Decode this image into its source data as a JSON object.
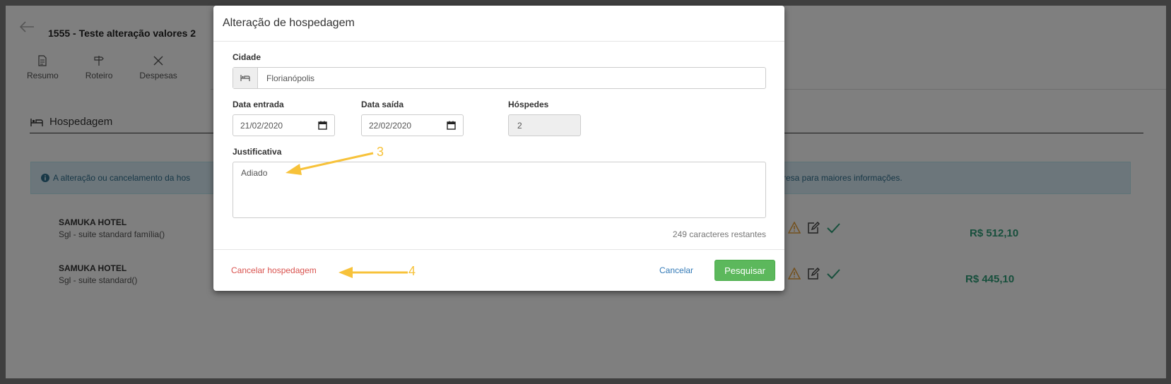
{
  "trip": {
    "title": "1555 - Teste alteração valores 2"
  },
  "nav": [
    {
      "label": "Resumo",
      "icon": "document-icon"
    },
    {
      "label": "Roteiro",
      "icon": "signpost-icon"
    },
    {
      "label": "Despesas",
      "icon": "utensils-icon"
    }
  ],
  "section": {
    "title": "Hospedagem",
    "icon": "bed-icon"
  },
  "info": {
    "text_left": "A alteração ou cancelamento da hos",
    "text_right": "resa para maiores informações."
  },
  "hotels": [
    {
      "name": "SAMUKA HOTEL",
      "room": "Sgl - suite standard família()",
      "price": "R$ 512,10"
    },
    {
      "name": "SAMUKA HOTEL",
      "room": "Sgl - suite standard()",
      "price": "R$ 445,10"
    }
  ],
  "modal": {
    "title": "Alteração de hospedagem",
    "city_label": "Cidade",
    "city_value": "Florianópolis",
    "date_in_label": "Data entrada",
    "date_in_value": "21/02/2020",
    "date_out_label": "Data saída",
    "date_out_value": "22/02/2020",
    "guests_label": "Hóspedes",
    "guests_value": "2",
    "justification_label": "Justificativa",
    "justification_value": "Adiado",
    "remaining": "249 caracteres restantes",
    "cancel_hosp": "Cancelar hospedagem",
    "cancel": "Cancelar",
    "search": "Pesquisar"
  },
  "annotations": {
    "arrow_3": "3",
    "arrow_4": "4"
  },
  "colors": {
    "accent_green": "#5cb85c",
    "price_green": "#2e9e78",
    "danger": "#d9534f",
    "link": "#337ab7",
    "annotation": "#f7c23a",
    "warning": "#e8a13b"
  }
}
